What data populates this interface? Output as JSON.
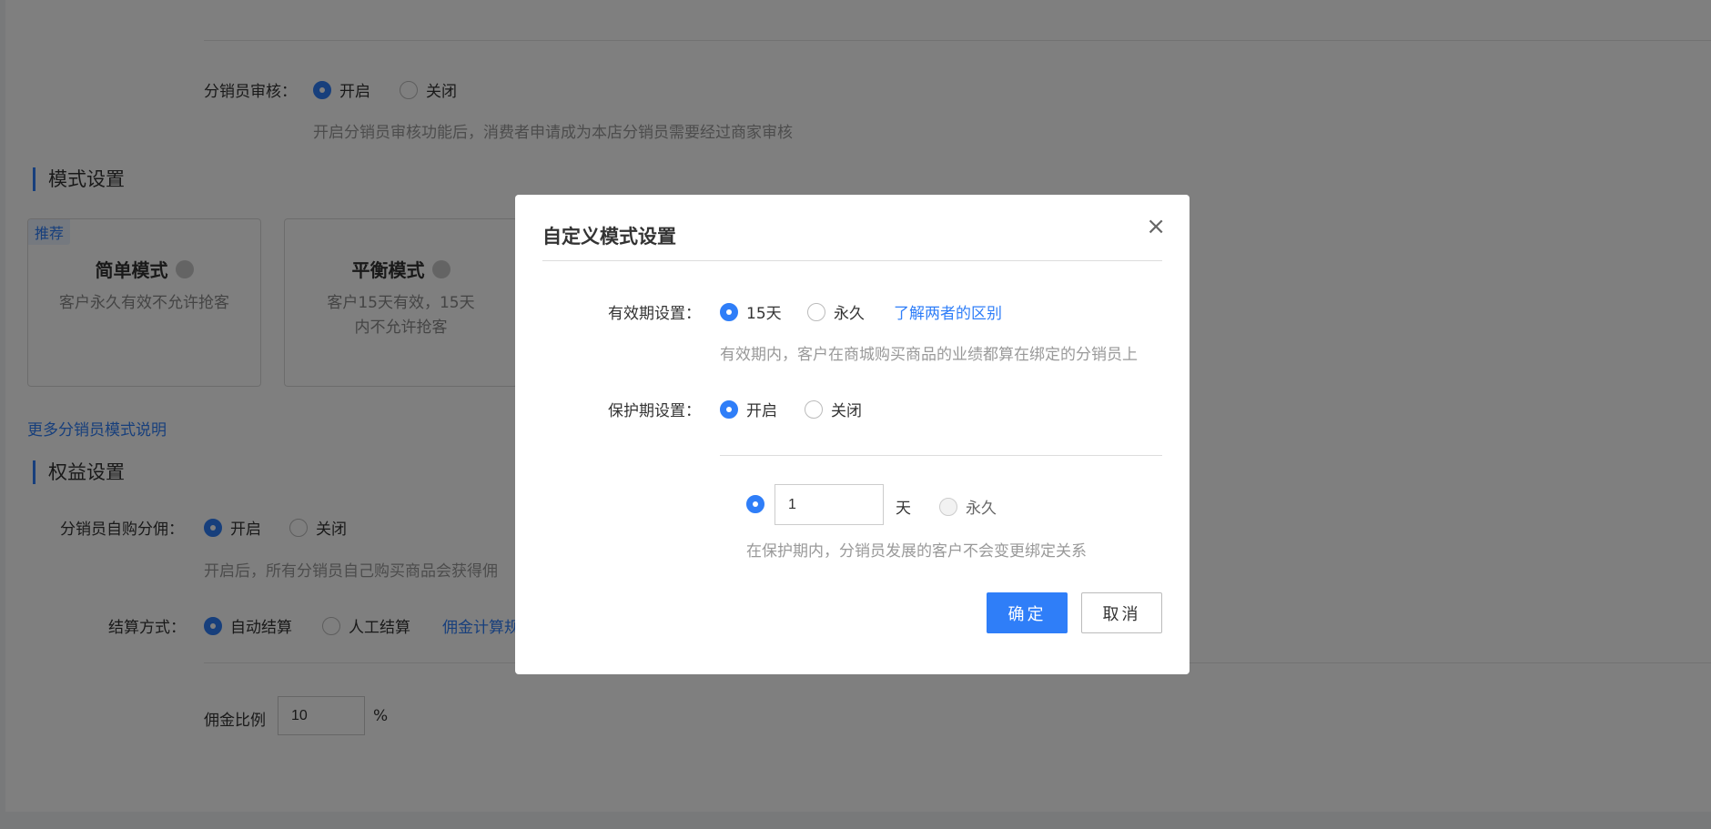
{
  "background": {
    "audit": {
      "label": "分销员审核：",
      "options": [
        "开启",
        "关闭"
      ],
      "selected": 0,
      "hint": "开启分销员审核功能后，消费者申请成为本店分销员需要经过商家审核"
    },
    "mode_section": {
      "title": "模式设置",
      "cards": [
        {
          "tag": "推荐",
          "name": "简单模式",
          "desc": "客户永久有效不允许抢客"
        },
        {
          "name": "平衡模式",
          "desc": "客户15天有效，15天内不允许抢客"
        }
      ],
      "more_link": "更多分销员模式说明"
    },
    "rights_section": {
      "title": "权益设置",
      "self_buy": {
        "label": "分销员自购分佣：",
        "options": [
          "开启",
          "关闭"
        ],
        "selected": 0,
        "hint": "开启后，所有分销员自己购买商品会获得佣"
      },
      "settlement": {
        "label": "结算方式：",
        "options": [
          "自动结算",
          "人工结算"
        ],
        "selected": 0,
        "link": "佣金计算规"
      },
      "commission": {
        "label": "佣金比例",
        "value": "10",
        "unit": "%"
      }
    }
  },
  "modal": {
    "title": "自定义模式设置",
    "close_icon": "×",
    "validity": {
      "label": "有效期设置：",
      "options": [
        "15天",
        "永久"
      ],
      "selected": 0,
      "link": "了解两者的区别",
      "hint": "有效期内，客户在商城购买商品的业绩都算在绑定的分销员上"
    },
    "protection": {
      "label": "保护期设置：",
      "options": [
        "开启",
        "关闭"
      ],
      "selected": 0,
      "days_value": "1",
      "days_unit": "天",
      "forever_label": "永久",
      "hint": "在保护期内，分销员发展的客户不会变更绑定关系"
    },
    "buttons": {
      "confirm": "确定",
      "cancel": "取消"
    }
  },
  "colors": {
    "accent": "#2f7ef8",
    "overlay": "rgba(0,0,0,0.5)"
  }
}
